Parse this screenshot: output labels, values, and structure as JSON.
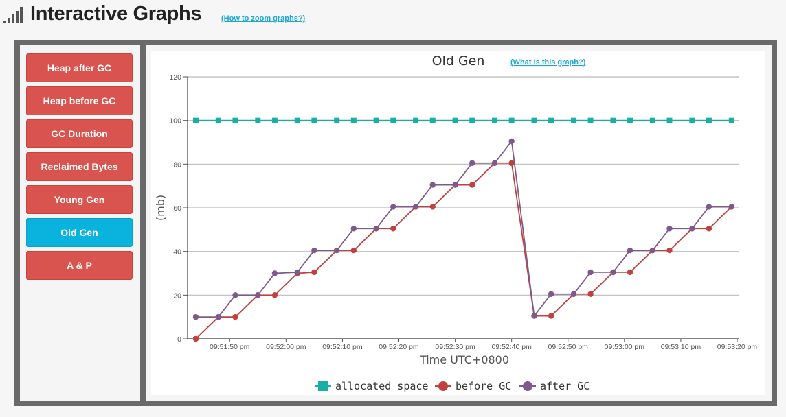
{
  "header": {
    "title": "Interactive Graphs",
    "zoom_link": "(How to zoom graphs?)",
    "icon": "signal-bars-icon"
  },
  "sidebar": {
    "items": [
      {
        "label": "Heap after GC",
        "active": false
      },
      {
        "label": "Heap before GC",
        "active": false
      },
      {
        "label": "GC Duration",
        "active": false
      },
      {
        "label": "Reclaimed Bytes",
        "active": false
      },
      {
        "label": "Young Gen",
        "active": false
      },
      {
        "label": "Old Gen",
        "active": true
      },
      {
        "label": "A & P",
        "active": false
      }
    ]
  },
  "colors": {
    "nav": "#d9534f",
    "nav_active": "#0ab3de",
    "allocated": "#1aafa5",
    "before": "#c0413f",
    "after": "#7d5a8a"
  },
  "chart_data": {
    "type": "line",
    "title": "Old Gen",
    "help_link": "(What is this graph?)",
    "xlabel": "Time UTC+0800",
    "ylabel": "(mb)",
    "ylim": [
      0,
      120
    ],
    "yticks": [
      0,
      20,
      40,
      60,
      80,
      100,
      120
    ],
    "xlim": [
      "09:51:44",
      "09:53:20"
    ],
    "xticks": [
      "09:51:50 pm",
      "09:52:00 pm",
      "09:52:10 pm",
      "09:52:20 pm",
      "09:52:30 pm",
      "09:52:40 pm",
      "09:52:50 pm",
      "09:53:00 pm",
      "09:53:10 pm",
      "09:53:20 pm"
    ],
    "grid": true,
    "legend_position": "bottom-center",
    "series": [
      {
        "name": "allocated space",
        "marker": "square",
        "x": [
          "09:51:44",
          "09:51:48",
          "09:51:51",
          "09:51:55",
          "09:51:58",
          "09:52:02",
          "09:52:05",
          "09:52:09",
          "09:52:12",
          "09:52:16",
          "09:52:19",
          "09:52:23",
          "09:52:26",
          "09:52:30",
          "09:52:33",
          "09:52:37",
          "09:52:40",
          "09:52:44",
          "09:52:47",
          "09:52:51",
          "09:52:54",
          "09:52:58",
          "09:53:01",
          "09:53:05",
          "09:53:08",
          "09:53:12",
          "09:53:15",
          "09:53:19"
        ],
        "values": [
          100,
          100,
          100,
          100,
          100,
          100,
          100,
          100,
          100,
          100,
          100,
          100,
          100,
          100,
          100,
          100,
          100,
          100,
          100,
          100,
          100,
          100,
          100,
          100,
          100,
          100,
          100,
          100
        ]
      },
      {
        "name": "before GC",
        "marker": "circle",
        "x": [
          "09:51:44",
          "09:51:48",
          "09:51:51",
          "09:51:55",
          "09:51:58",
          "09:52:02",
          "09:52:05",
          "09:52:09",
          "09:52:12",
          "09:52:16",
          "09:52:19",
          "09:52:23",
          "09:52:26",
          "09:52:30",
          "09:52:33",
          "09:52:37",
          "09:52:40",
          "09:52:44",
          "09:52:47",
          "09:52:51",
          "09:52:54",
          "09:52:58",
          "09:53:01",
          "09:53:05",
          "09:53:08",
          "09:53:12",
          "09:53:15",
          "09:53:19"
        ],
        "values": [
          0,
          10,
          10,
          20,
          20,
          30,
          30.5,
          40.5,
          40.5,
          50.5,
          50.5,
          60.5,
          60.5,
          70.5,
          70.5,
          80.5,
          80.5,
          10.5,
          10.5,
          20.5,
          20.5,
          30.5,
          30.5,
          40.5,
          40.5,
          50.5,
          50.5,
          60.5
        ]
      },
      {
        "name": "after GC",
        "marker": "circle",
        "x": [
          "09:51:44",
          "09:51:48",
          "09:51:51",
          "09:51:55",
          "09:51:58",
          "09:52:02",
          "09:52:05",
          "09:52:09",
          "09:52:12",
          "09:52:16",
          "09:52:19",
          "09:52:23",
          "09:52:26",
          "09:52:30",
          "09:52:33",
          "09:52:37",
          "09:52:40",
          "09:52:44",
          "09:52:47",
          "09:52:51",
          "09:52:54",
          "09:52:58",
          "09:53:01",
          "09:53:05",
          "09:53:08",
          "09:53:12",
          "09:53:15",
          "09:53:19"
        ],
        "values": [
          10,
          10,
          20,
          20,
          30,
          30.5,
          40.5,
          40.5,
          50.5,
          50.5,
          60.5,
          60.5,
          70.5,
          70.5,
          80.5,
          80.5,
          90.5,
          10.5,
          20.5,
          20.5,
          30.5,
          30.5,
          40.5,
          40.5,
          50.5,
          50.5,
          60.5,
          60.5
        ]
      }
    ]
  }
}
